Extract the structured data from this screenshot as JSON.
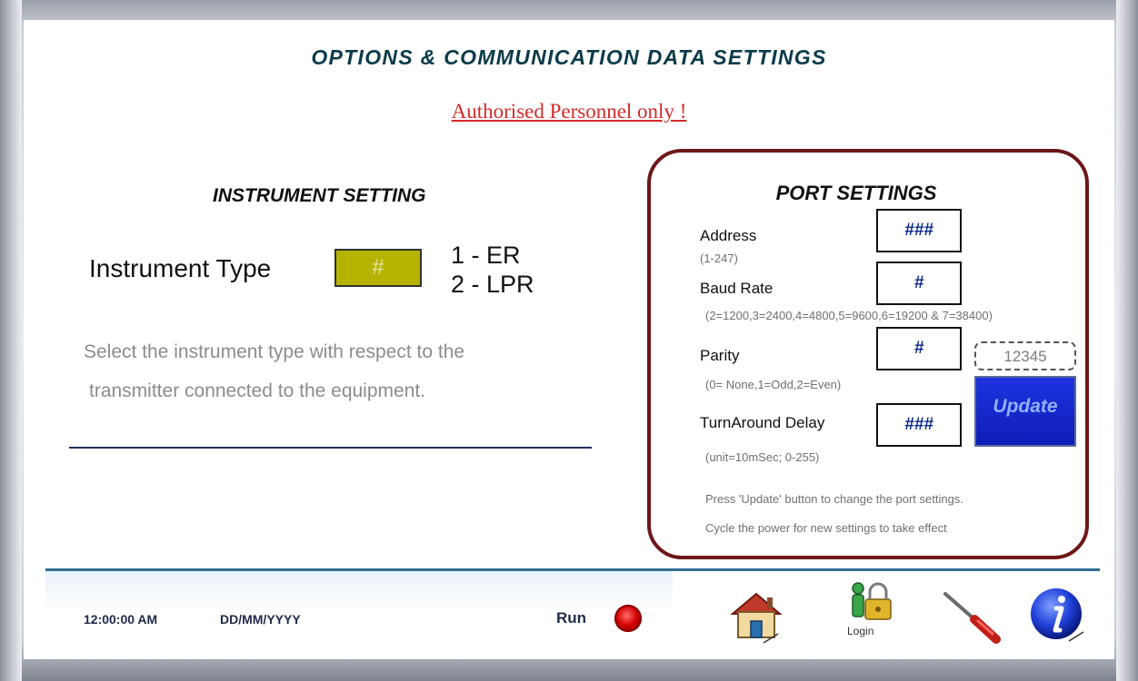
{
  "header": {
    "title": "OPTIONS & COMMUNICATION DATA SETTINGS",
    "warning": "Authorised Personnel only !"
  },
  "instrument": {
    "section_title": "INSTRUMENT SETTING",
    "type_label": "Instrument Type",
    "type_value": "#",
    "options": [
      "1 - ER",
      "2 - LPR"
    ],
    "description_lines": [
      "Select the instrument type with respect to the",
      "transmitter connected to the equipment."
    ]
  },
  "port": {
    "section_title": "PORT SETTINGS",
    "address": {
      "label": "Address",
      "hint": "(1-247)",
      "value": "###"
    },
    "baud_rate": {
      "label": "Baud Rate",
      "hint": "(2=1200,3=2400,4=4800,5=9600,6=19200 & 7=38400)",
      "value": "#"
    },
    "parity": {
      "label": "Parity",
      "hint": "(0= None,1=Odd,2=Even)",
      "value": "#"
    },
    "turnaround": {
      "label": "TurnAround Delay",
      "hint": "(unit=10mSec; 0-255)",
      "value": "###"
    },
    "password_value": "12345",
    "update_label": "Update",
    "notes": [
      "Press 'Update' button to change the port settings.",
      "Cycle the power for new settings to take effect"
    ]
  },
  "footer": {
    "time": "12:00:00 AM",
    "date": "DD/MM/YYYY",
    "run_label": "Run",
    "login_label": "Login",
    "icons": [
      "home-icon",
      "login-icon",
      "tools-icon",
      "info-icon"
    ]
  },
  "colors": {
    "title": "#0b3b49",
    "warning": "#d42a2a",
    "instrument_box": "#b5b300",
    "port_border": "#6e1718",
    "update_button": "#1626d0",
    "run_led": "#d40000"
  }
}
